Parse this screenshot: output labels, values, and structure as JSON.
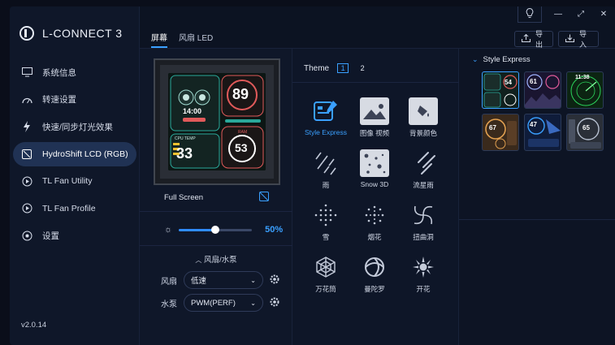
{
  "app": {
    "title": "L-CONNECT 3",
    "version": "v2.0.14"
  },
  "sidebar": {
    "items": [
      {
        "label": "系统信息",
        "icon": "monitor-icon"
      },
      {
        "label": "转速设置",
        "icon": "speedometer-icon"
      },
      {
        "label": "快速/同步灯光效果",
        "icon": "lightning-icon"
      },
      {
        "label": "HydroShift LCD (RGB)",
        "icon": "lcd-icon",
        "active": true
      },
      {
        "label": "TL Fan Utility",
        "icon": "fan-utility-icon"
      },
      {
        "label": "TL Fan Profile",
        "icon": "fan-profile-icon"
      },
      {
        "label": "设置",
        "icon": "settings-icon"
      }
    ]
  },
  "header": {
    "tabs": [
      {
        "label": "屏幕",
        "active": true
      },
      {
        "label": "风扇 LED",
        "active": false
      }
    ],
    "export_label": "导出",
    "import_label": "导入"
  },
  "lcd": {
    "fullscreen_label": "Full Screen",
    "preview": {
      "time": "14:00",
      "temp_big": "89",
      "cpu_label": "CPU TEMP",
      "cpu_temp": "33",
      "ram_label": "RAM",
      "ram_value": "53"
    }
  },
  "brightness": {
    "value_label": "50%",
    "level": 0.5
  },
  "fan_pump": {
    "section_title": "风扇/水泵",
    "fan_label": "风扇",
    "fan_value": "低速",
    "pump_label": "水泵",
    "pump_value": "PWM(PERF)"
  },
  "theme": {
    "label": "Theme",
    "pages": [
      "1",
      "2"
    ],
    "active_page": "1",
    "items": [
      {
        "label": "Style Express",
        "icon": "style-express-icon",
        "active": true
      },
      {
        "label": "图像 视频",
        "icon": "image-video-icon"
      },
      {
        "label": "背景颜色",
        "icon": "background-color-icon"
      },
      {
        "label": "雨",
        "icon": "rain-icon"
      },
      {
        "label": "Snow 3D",
        "icon": "snow-3d-icon"
      },
      {
        "label": "流星雨",
        "icon": "meteor-shower-icon"
      },
      {
        "label": "雪",
        "icon": "snow-icon"
      },
      {
        "label": "烟花",
        "icon": "fireworks-icon"
      },
      {
        "label": "扭曲洞",
        "icon": "vortex-icon"
      },
      {
        "label": "万花筒",
        "icon": "kaleidoscope-icon"
      },
      {
        "label": "曼陀罗",
        "icon": "mandala-icon"
      },
      {
        "label": "开花",
        "icon": "blossom-icon"
      }
    ]
  },
  "style_express": {
    "title": "Style Express",
    "thumbnails": [
      {
        "label": "54",
        "active": true
      },
      {
        "label": "61"
      },
      {
        "label": "11:38"
      },
      {
        "label": "67"
      },
      {
        "label": "47"
      },
      {
        "label": "65"
      }
    ]
  },
  "colors": {
    "accent": "#3aa0ff",
    "background": "#0d1424",
    "sidebar_active": "#203254"
  }
}
